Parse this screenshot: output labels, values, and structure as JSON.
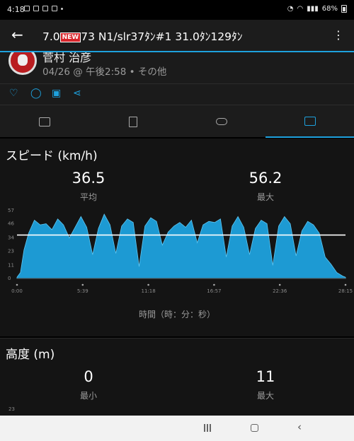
{
  "status_bar": {
    "time": "4:18",
    "battery": "68%"
  },
  "app_bar": {
    "title_pre": "7.0",
    "new_badge": "NEW",
    "title_post": "73 N1/slr37ﾀﾝ#1 31.0ﾀﾝ129ﾀﾝ"
  },
  "profile": {
    "name": "菅村 治彦",
    "date": "04/26 @ 午後2:58 • その他"
  },
  "speed": {
    "title": "スピード (km/h)",
    "avg_value": "36.5",
    "avg_label": "平均",
    "max_value": "56.2",
    "max_label": "最大",
    "x_axis_title": "時間（時：分：秒）"
  },
  "altitude": {
    "title": "高度 (m)",
    "min_value": "0",
    "min_label": "最小",
    "max_value": "11",
    "max_label": "最大",
    "first_tick": "23"
  },
  "colors": {
    "accent": "#1ea1dd",
    "avg_line": "#ffffff",
    "background": "#141414"
  },
  "icons": [
    "back-arrow-icon",
    "more-vert-icon",
    "heart-icon",
    "comment-icon",
    "camera-icon",
    "share-icon",
    "summary-tab-icon",
    "details-tab-icon",
    "laps-tab-icon",
    "charts-tab-icon"
  ],
  "chart_data": {
    "type": "area",
    "title": "スピード (km/h)",
    "xlabel": "時間（時：分：秒）",
    "ylabel": "",
    "y_ticks": [
      0,
      11,
      23,
      34,
      46,
      57
    ],
    "x_ticks": [
      "0:00",
      "5:39",
      "11:18",
      "16:57",
      "22:36",
      "28:15"
    ],
    "ylim": [
      0,
      57
    ],
    "average": 36.5,
    "max": 56.2,
    "x": [
      0,
      0.3,
      0.6,
      1.0,
      1.5,
      2.0,
      2.5,
      3.0,
      3.5,
      4.0,
      4.5,
      5.0,
      5.5,
      6.0,
      6.5,
      7.0,
      7.5,
      8.0,
      8.5,
      9.0,
      9.5,
      10.0,
      10.5,
      11.0,
      11.5,
      12.0,
      12.5,
      13.0,
      13.5,
      14.0,
      14.5,
      15.0,
      15.5,
      16.0,
      16.5,
      17.0,
      17.5,
      18.0,
      18.5,
      19.0,
      19.5,
      20.0,
      20.5,
      21.0,
      21.5,
      22.0,
      22.5,
      23.0,
      23.5,
      24.0,
      24.5,
      25.0,
      25.5,
      26.0,
      26.5,
      27.0,
      27.5,
      28.0,
      28.25
    ],
    "values": [
      1,
      5,
      24,
      38,
      49,
      45,
      46,
      41,
      50,
      45,
      34,
      43,
      52,
      43,
      20,
      42,
      54,
      45,
      21,
      44,
      50,
      47,
      10,
      44,
      51,
      48,
      28,
      39,
      44,
      47,
      43,
      49,
      30,
      45,
      48,
      47,
      50,
      18,
      44,
      52,
      43,
      20,
      42,
      49,
      46,
      11,
      44,
      52,
      46,
      19,
      40,
      48,
      45,
      38,
      18,
      12,
      5,
      2,
      1
    ]
  }
}
